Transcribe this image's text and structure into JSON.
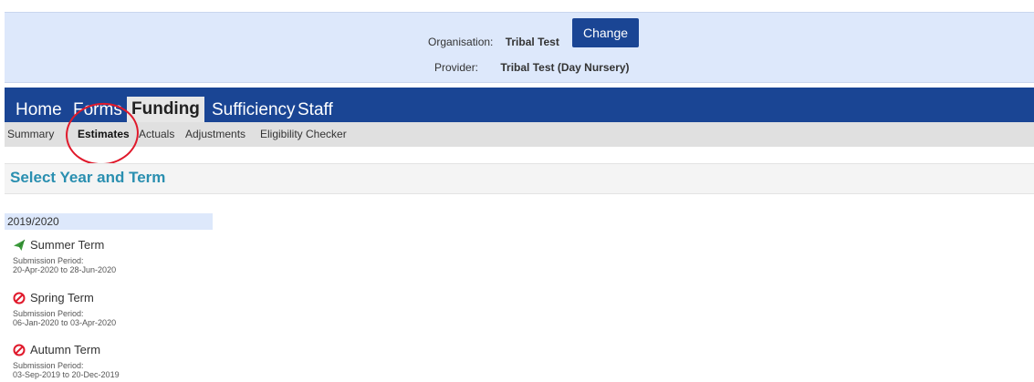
{
  "header": {
    "organisation_label": "Organisation:",
    "organisation_value": "Tribal Test",
    "change_label": "Change",
    "provider_label": "Provider:",
    "provider_value": "Tribal Test (Day Nursery)"
  },
  "main_nav": {
    "items": [
      {
        "label": "Home"
      },
      {
        "label": "Forms"
      },
      {
        "label": "Funding",
        "active": true
      },
      {
        "label": "Sufficiency"
      },
      {
        "label": "Staff"
      }
    ]
  },
  "sub_nav": {
    "items": [
      {
        "label": "Summary"
      },
      {
        "label": "Estimates",
        "active": true
      },
      {
        "label": "Actuals"
      },
      {
        "label": "Adjustments"
      },
      {
        "label": "Eligibility Checker"
      }
    ]
  },
  "section": {
    "title": "Select Year and Term"
  },
  "year": {
    "label": "2019/2020",
    "terms": [
      {
        "name": "Summer Term",
        "status_icon": "send-icon",
        "status_color": "#3a9a3a",
        "period_label": "Submission Period:",
        "period": "20-Apr-2020 to 28-Jun-2020"
      },
      {
        "name": "Spring Term",
        "status_icon": "blocked-icon",
        "status_color": "#e0192b",
        "period_label": "Submission Period:",
        "period": "06-Jan-2020 to 03-Apr-2020"
      },
      {
        "name": "Autumn Term",
        "status_icon": "blocked-icon",
        "status_color": "#e0192b",
        "period_label": "Submission Period:",
        "period": "03-Sep-2019 to 20-Dec-2019"
      }
    ]
  },
  "colors": {
    "nav_bg": "#1a4594",
    "header_bg": "#dde8fb",
    "title_color": "#2a8fb0",
    "annotation": "#e0192b"
  }
}
